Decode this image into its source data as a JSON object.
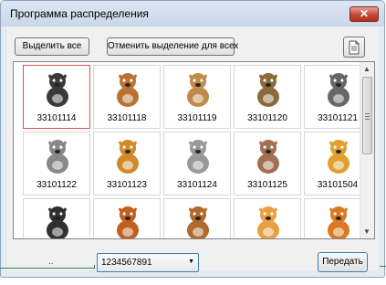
{
  "window": {
    "title": "Программа распределения",
    "close_label": "✕"
  },
  "toolbar": {
    "select_all_label": "Выделить все",
    "deselect_all_label": "Отменить выделение для всех",
    "doc_icon": "document-icon"
  },
  "gallery": {
    "items": [
      {
        "id": "33101114",
        "icon": "husky-dog-icon",
        "selected": true
      },
      {
        "id": "33101118",
        "icon": "pointer-dog-icon"
      },
      {
        "id": "33101119",
        "icon": "spaniel-dog-icon"
      },
      {
        "id": "33101120",
        "icon": "terrier-dog-icon"
      },
      {
        "id": "33101121",
        "icon": "schnauzer-dog-icon"
      },
      {
        "id": "33101122",
        "icon": "persian-cat-icon"
      },
      {
        "id": "33101123",
        "icon": "ginger-cat-icon"
      },
      {
        "id": "33101124",
        "icon": "white-cat-icon"
      },
      {
        "id": "33101125",
        "icon": "calico-cat-icon"
      },
      {
        "id": "33101504",
        "icon": "teddy-bear-icon"
      },
      {
        "id": "",
        "icon": "bear-balloons-icon"
      },
      {
        "id": "",
        "icon": "bear-sitting-icon"
      },
      {
        "id": "",
        "icon": "bear-net-icon"
      },
      {
        "id": "",
        "icon": "bear-duck-icon"
      },
      {
        "id": "",
        "icon": "bear-ball-icon"
      }
    ]
  },
  "footer": {
    "machine_label_mark": "..",
    "combo_value": "1234567891",
    "send_label": "Передать"
  },
  "colors": {
    "selected_border": "#d9534f",
    "close_red": "#c44a35",
    "callout_green": "#2e8b57"
  }
}
